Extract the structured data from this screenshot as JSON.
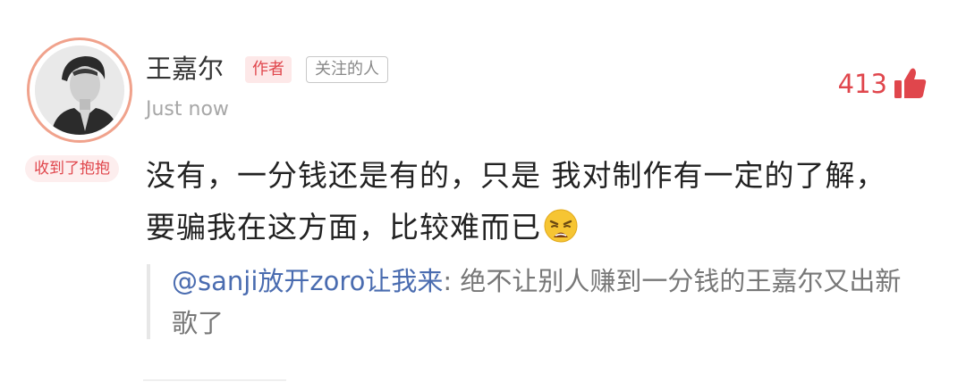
{
  "comment": {
    "username": "王嘉尔",
    "author_tag": "作者",
    "follow_tag": "关注的人",
    "timestamp": "Just now",
    "badge": "收到了抱抱",
    "likes": "413",
    "text_line1": "没有，一分钱还是有的，只是 我对制作有一定的了解，",
    "text_line2": "要骗我在这方面，比较难而已",
    "emoji": "weary-face-emoji",
    "quote": {
      "mention": "@sanji放开zoro让我来",
      "separator": ": ",
      "text": "绝不让别人赚到一分钱的王嘉尔又出新歌了"
    }
  },
  "colors": {
    "accent_red": "#e0464c",
    "mention_blue": "#4a6cb0",
    "avatar_ring": "#f0a28c"
  },
  "icons": {
    "like": "thumbs-up-icon",
    "emoji": "weary-face-emoji"
  }
}
